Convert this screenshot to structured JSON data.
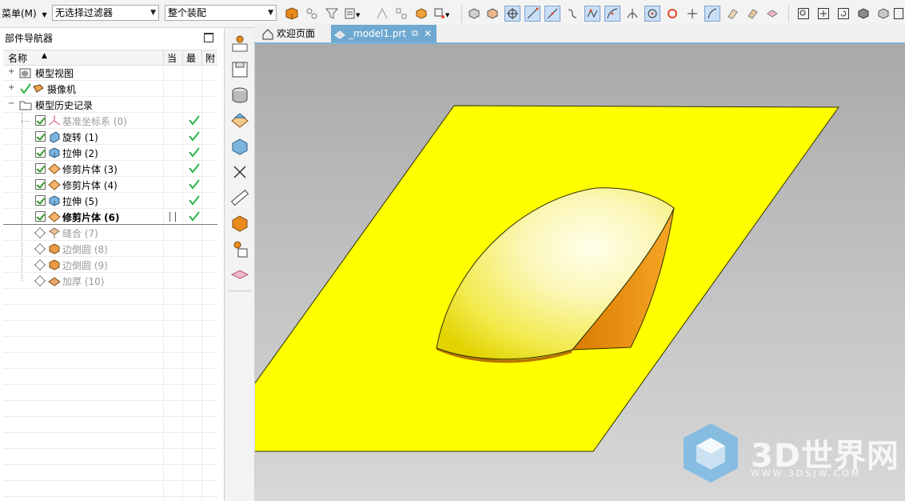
{
  "toolbar": {
    "menu_label": "菜单(M)",
    "filter_value": "无选择过滤器",
    "scope_value": "整个装配"
  },
  "navigator": {
    "title": "部件导航器",
    "columns": {
      "name": "名称",
      "current": "当",
      "latest": "最",
      "attached": "附"
    },
    "nodes": [
      {
        "label": "模型视图",
        "state": "group"
      },
      {
        "label": "摄像机",
        "state": "group"
      },
      {
        "label": "模型历史记录",
        "state": "group"
      },
      {
        "label": "基准坐标系 (0)",
        "state": "suppressed-style"
      },
      {
        "label": "旋转 (1)",
        "state": "active"
      },
      {
        "label": "拉伸 (2)",
        "state": "active"
      },
      {
        "label": "修剪片体 (3)",
        "state": "active"
      },
      {
        "label": "修剪片体 (4)",
        "state": "active"
      },
      {
        "label": "拉伸 (5)",
        "state": "active"
      },
      {
        "label": "修剪片体 (6)",
        "state": "current"
      },
      {
        "label": "缝合 (7)",
        "state": "inactive"
      },
      {
        "label": "边倒圆 (8)",
        "state": "inactive"
      },
      {
        "label": "边倒圆 (9)",
        "state": "inactive"
      },
      {
        "label": "加厚 (10)",
        "state": "inactive"
      }
    ]
  },
  "tabs": {
    "welcome": "欢迎页面",
    "model": "_model1.prt"
  },
  "watermark": {
    "brand": "3D世界网",
    "url": "WWW.3DSJW.COM"
  },
  "colors": {
    "sheet": "#ffff00",
    "dome_inner": "#f29a0f",
    "tab_active": "#6fa9d2",
    "check_green": "#2fb34a"
  }
}
